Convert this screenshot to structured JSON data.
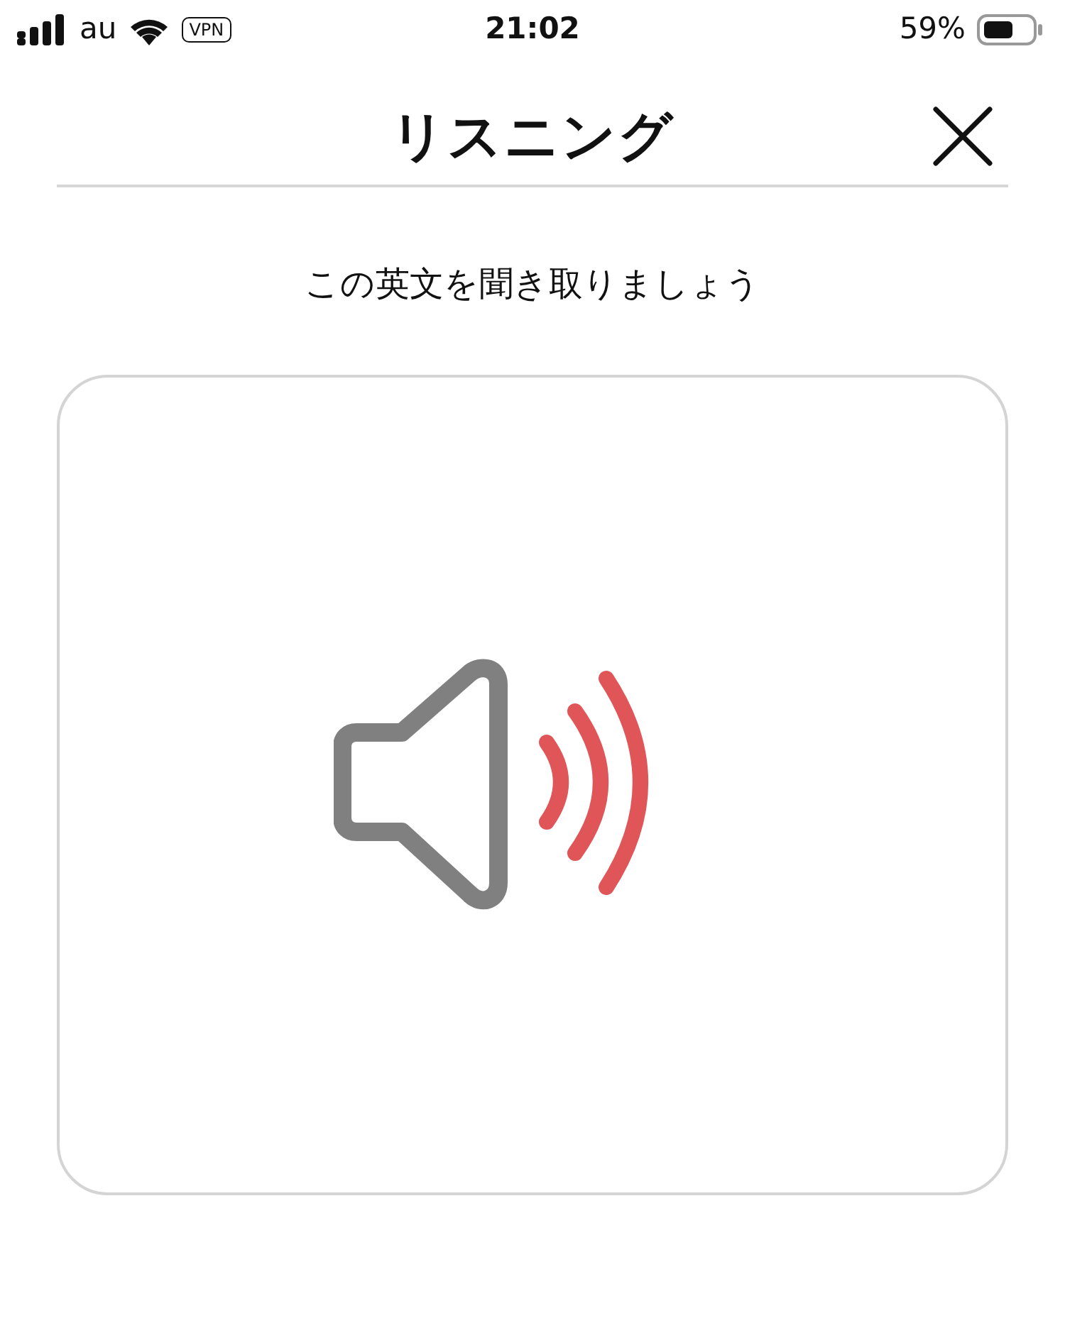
{
  "status_bar": {
    "carrier": "au",
    "vpn": "VPN",
    "time": "21:02",
    "battery": "59%"
  },
  "header": {
    "title": "リスニング"
  },
  "instruction": "この英文を聞き取りましょう"
}
